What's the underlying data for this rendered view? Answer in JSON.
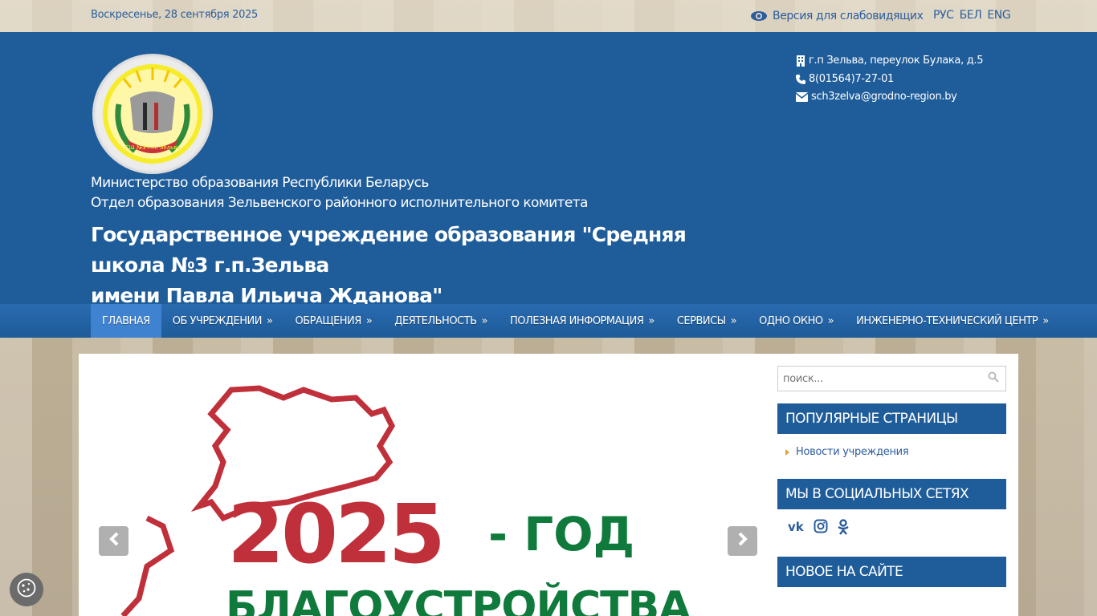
{
  "topbar": {
    "date": "Воскресенье, 28 сентября 2025",
    "vision_label": "Версия для слабовидящих",
    "languages": [
      "РУС",
      "БЕЛ",
      "ENG"
    ]
  },
  "header": {
    "ministry_line1": "Министерство образования Республики Беларусь",
    "ministry_line2": "Отдел образования Зельвенского районного исполнительного комитета",
    "school_line1": "Государственное учреждение образования \"Средняя школа №3 г.п.Зельва",
    "school_line2": "имени Павла Ильича Жданова\"",
    "logo_text": "СШ №3 г.п. Зельва",
    "address": "г.п Зельва, переулок Булака, д.5",
    "phone": "8(01564)7-27-01",
    "email": "sch3zelva@grodno-region.by"
  },
  "nav": {
    "items": [
      {
        "label": "Главная",
        "arrow": ""
      },
      {
        "label": "Об учреждении",
        "arrow": "»"
      },
      {
        "label": "Обращения",
        "arrow": "»"
      },
      {
        "label": "Деятельность",
        "arrow": "»"
      },
      {
        "label": "Полезная информация",
        "arrow": "»"
      },
      {
        "label": "Сервисы",
        "arrow": "»"
      },
      {
        "label": "Одно окно",
        "arrow": "»"
      },
      {
        "label": "Инженерно-технический центр",
        "arrow": "»"
      }
    ]
  },
  "slider": {
    "year": "2025",
    "dash_title": "- ГОД",
    "subtitle": "БЛАГОУСТРОЙСТВА"
  },
  "sidebar": {
    "search_placeholder": "поиск...",
    "popular_title": "Популярные страницы",
    "popular_link": "Новости учреждения",
    "social_title": "Мы в социальных сетях",
    "new_title": "Новое на сайте"
  },
  "colors": {
    "header_blue": "#1e5c9a",
    "nav_active": "#3f83d0",
    "slide_red": "#c0303a",
    "slide_green": "#0f7a3b"
  }
}
